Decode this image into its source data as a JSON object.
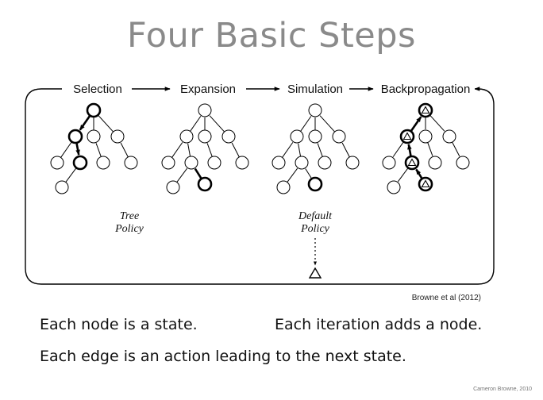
{
  "slide": {
    "title": "Four Basic Steps",
    "citation": "Browne et al (2012)",
    "captions": {
      "node_state": "Each node is a state.",
      "iteration_adds": "Each iteration adds a node.",
      "edge_action": "Each edge is an action leading to the next state."
    },
    "credit": "Cameron Browne, 2010"
  },
  "diagram": {
    "steps": [
      "Selection",
      "Expansion",
      "Simulation",
      "Backpropagation"
    ],
    "tree_policy": {
      "line1": "Tree",
      "line2": "Policy"
    },
    "default_policy": {
      "line1": "Default",
      "line2": "Policy"
    }
  }
}
